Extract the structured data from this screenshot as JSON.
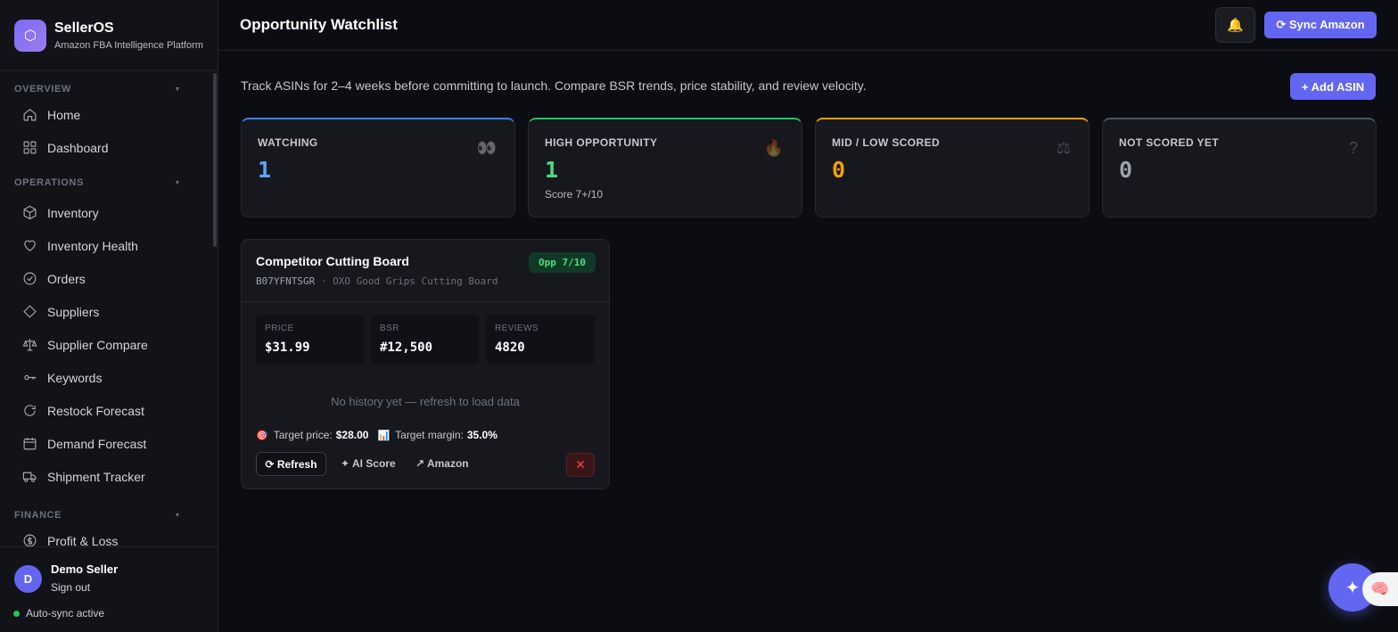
{
  "brand": {
    "logo_glyph": "⬡",
    "name": "SellerOS",
    "tagline": "Amazon FBA Intelligence Platform"
  },
  "sidebar": {
    "sections": [
      {
        "title": "OVERVIEW",
        "items": [
          {
            "label": "Home",
            "icon": "home-icon"
          },
          {
            "label": "Dashboard",
            "icon": "grid-icon"
          }
        ]
      },
      {
        "title": "OPERATIONS",
        "items": [
          {
            "label": "Inventory",
            "icon": "box-icon"
          },
          {
            "label": "Inventory Health",
            "icon": "heart-icon"
          },
          {
            "label": "Orders",
            "icon": "check-circle-icon"
          },
          {
            "label": "Suppliers",
            "icon": "diamond-icon"
          },
          {
            "label": "Supplier Compare",
            "icon": "scale-icon"
          },
          {
            "label": "Keywords",
            "icon": "key-icon"
          },
          {
            "label": "Restock Forecast",
            "icon": "refresh-icon"
          },
          {
            "label": "Demand Forecast",
            "icon": "calendar-icon"
          },
          {
            "label": "Shipment Tracker",
            "icon": "truck-icon"
          }
        ]
      },
      {
        "title": "FINANCE",
        "items": [
          {
            "label": "Profit & Loss",
            "icon": "dollar-icon"
          }
        ]
      }
    ],
    "section_chevron": "▼"
  },
  "user": {
    "initial": "D",
    "name": "Demo Seller",
    "signout_label": "Sign out",
    "sync_status": "Auto-sync active"
  },
  "header": {
    "title": "Opportunity Watchlist",
    "bell_glyph": "🔔",
    "sync_label": "⟳ Sync Amazon"
  },
  "main": {
    "description": "Track ASINs for 2–4 weeks before committing to launch. Compare BSR trends, price stability, and review velocity.",
    "add_label": "+ Add ASIN"
  },
  "stats": [
    {
      "label": "WATCHING",
      "value": "1",
      "sub": "",
      "icon": "👀",
      "accent": "#3b82f6",
      "color": "#60a5fa"
    },
    {
      "label": "HIGH OPPORTUNITY",
      "value": "1",
      "sub": "Score 7+/10",
      "icon": "🔥",
      "accent": "#22c55e",
      "color": "#4ade80"
    },
    {
      "label": "MID / LOW SCORED",
      "value": "0",
      "sub": "",
      "icon": "⚖",
      "accent": "#f59e0b",
      "color": "#f59e0b"
    },
    {
      "label": "NOT SCORED YET",
      "value": "0",
      "sub": "",
      "icon": "?",
      "accent": "#4b5563",
      "color": "#9ca3af"
    }
  ],
  "watch_item": {
    "title": "Competitor Cutting Board",
    "asin": "B07YFNTSGR",
    "separator": "·",
    "product": "OXO Good Grips Cutting Board",
    "badge": "Opp 7/10",
    "metrics": [
      {
        "label": "PRICE",
        "value": "$31.99"
      },
      {
        "label": "BSR",
        "value": "#12,500"
      },
      {
        "label": "REVIEWS",
        "value": "4820"
      }
    ],
    "no_history": "No history yet — refresh to load data",
    "target_price_emoji": "🎯",
    "target_price_label": "Target price:",
    "target_price_value": "$28.00",
    "target_margin_emoji": "📊",
    "target_margin_label": "Target margin:",
    "target_margin_value": "35.0%",
    "refresh_label": "⟳ Refresh",
    "ai_score_label": "✦ AI Score",
    "amazon_label": "↗ Amazon",
    "remove_glyph": "✕"
  },
  "fab": {
    "glyph": "✦"
  },
  "brain_tab": {
    "glyph": "🧠"
  }
}
